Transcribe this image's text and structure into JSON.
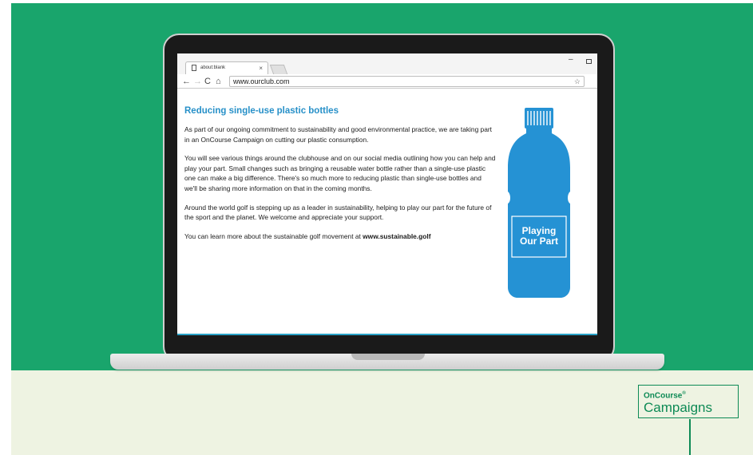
{
  "browser": {
    "tab_title": "about:blank",
    "tab_close": "×",
    "back_icon": "←",
    "forward_icon": "→",
    "reload_icon": "C",
    "home_icon": "⌂",
    "url": "www.ourclub.com",
    "bookmark_icon": "☆",
    "minimize_icon": "–"
  },
  "page": {
    "heading": "Reducing single-use plastic bottles",
    "paragraph_1": "As part of our ongoing commitment to sustainability and good environmental practice, we are taking part in an OnCourse Campaign on cutting our plastic consumption.",
    "paragraph_2": "You will see various things around the clubhouse and on our social media outlining how you can help and play your part. Small changes such as bringing a reusable water bottle rather than a single-use plastic one can make a big difference. There's so much more to reducing plastic than single-use bottles and we'll be sharing more information on that in the coming months.",
    "paragraph_3": "Around the world golf is stepping up as a leader in sustainability, helping to play our part for the future of the sport and the planet. We welcome and appreciate your support.",
    "paragraph_4_prefix": "You can learn more about the sustainable golf movement at ",
    "paragraph_4_link": "www.sustainable.golf",
    "bottle_label_line1": "Playing",
    "bottle_label_line2": "Our Part"
  },
  "logo": {
    "top": "OnCourse",
    "registered": "®",
    "bottom": "Campaigns"
  },
  "colors": {
    "background_green": "#19a56c",
    "background_cream": "#eef3e2",
    "heading_blue": "#2790c8",
    "bottle_blue": "#2592d4",
    "logo_green": "#0d8a55"
  }
}
